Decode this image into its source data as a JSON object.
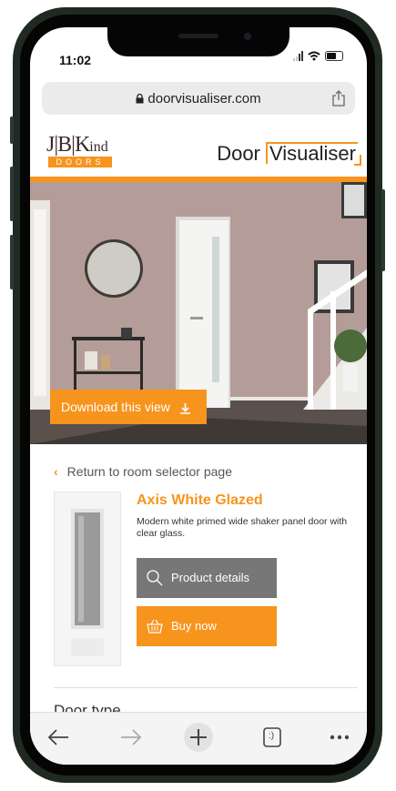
{
  "status": {
    "time": "11:02"
  },
  "browser": {
    "url": "doorvisualiser.com"
  },
  "header": {
    "logo_main": "J|B|K",
    "logo_ind": "ind",
    "logo_sub": "DOORS",
    "brand_prefix": "Door",
    "brand_boxed": "Visualiser"
  },
  "hero": {
    "download_label": "Download this view"
  },
  "product": {
    "return_label": "Return to room selector page",
    "name": "Axis White Glazed",
    "description": "Modern white primed wide shaker panel door with clear glass.",
    "details_label": "Product details",
    "buy_label": "Buy now"
  },
  "filters": {
    "door_type_label": "Door type"
  },
  "toolbar": {
    "tabs_label": ":)"
  },
  "colors": {
    "accent": "#f7941d",
    "details_button": "#777777",
    "wall": "#b49d98"
  },
  "icons": [
    "lock-icon",
    "share-icon",
    "download-icon",
    "chevron-left-icon",
    "magnifier-icon",
    "basket-icon",
    "back-arrow-icon",
    "forward-arrow-icon",
    "plus-icon",
    "tabs-icon",
    "more-icon"
  ]
}
